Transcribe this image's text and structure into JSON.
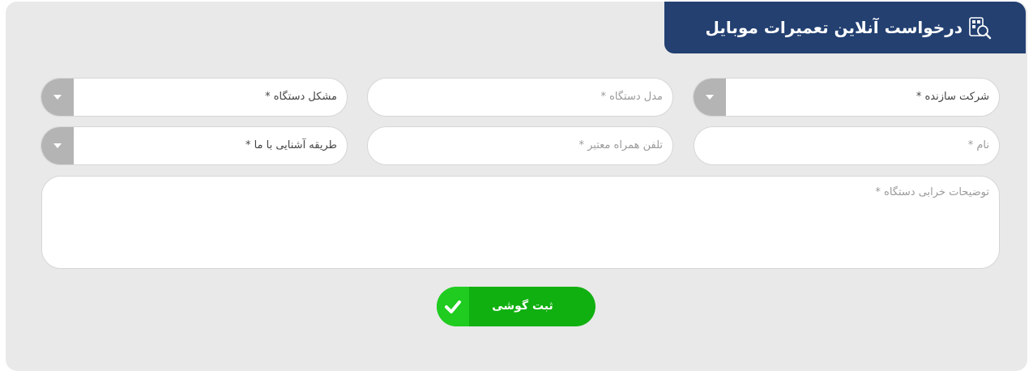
{
  "form": {
    "title": "درخواست آنلاین تعمیرات موبایل",
    "title_icon": "device-search-icon",
    "row1": {
      "manufacturer": {
        "value": "شرکت سازنده *",
        "type": "select"
      },
      "model": {
        "placeholder": "مدل دستگاه *",
        "type": "text"
      },
      "problem": {
        "value": "مشکل دستگاه *",
        "type": "select"
      }
    },
    "row2": {
      "name": {
        "placeholder": "نام *",
        "type": "text"
      },
      "phone": {
        "placeholder": "تلفن همراه معتبر *",
        "type": "text"
      },
      "referral": {
        "value": "طریقه آشنایی با ما *",
        "type": "select"
      }
    },
    "description": {
      "placeholder": "توضیحات خرابی دستگاه *"
    },
    "submit": {
      "label": "ثبت گوشی",
      "icon": "check-icon"
    }
  },
  "colors": {
    "panel_bg": "#e9e9e9",
    "title_bg": "#234071",
    "select_button": "#b4b4b4",
    "submit_bg": "#10b010",
    "submit_icon_bg": "#1fcc1f"
  }
}
